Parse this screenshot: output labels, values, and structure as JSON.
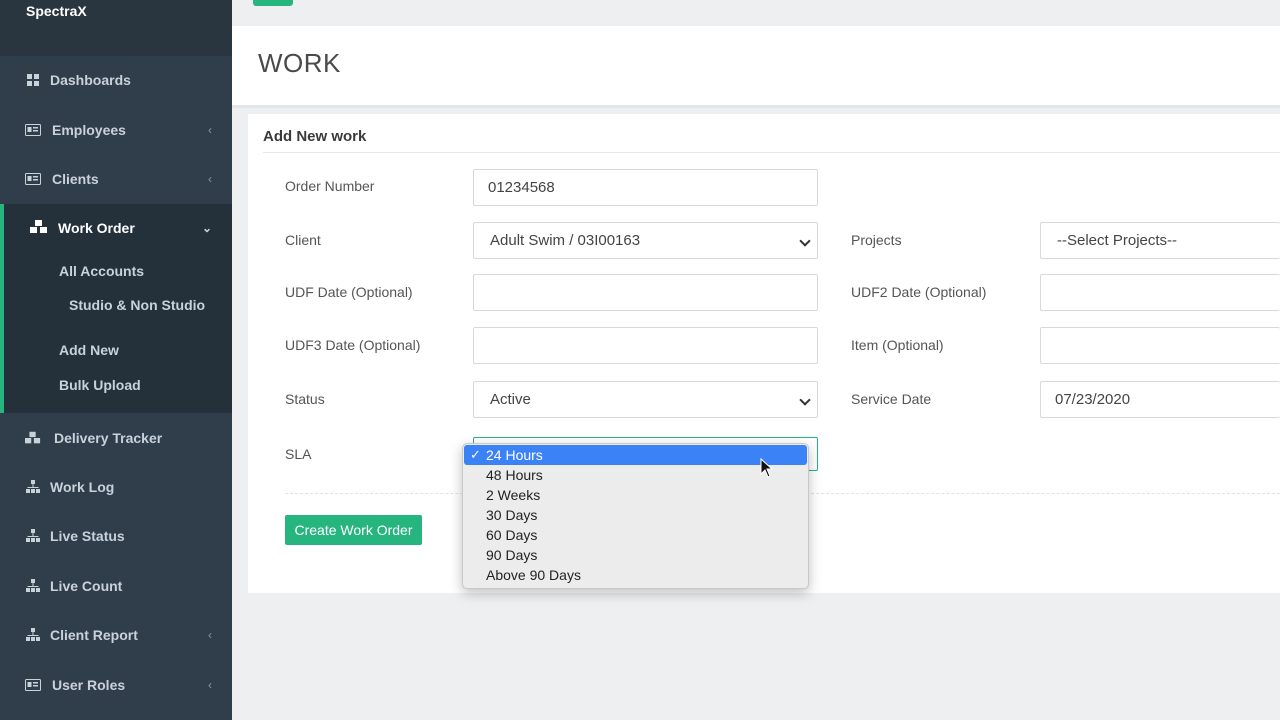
{
  "app": {
    "brand": "SpectraX"
  },
  "sidebar": {
    "items": [
      {
        "label": "Dashboards",
        "icon": "grid-icon",
        "has_chevron": false
      },
      {
        "label": "Employees",
        "icon": "id-card-icon",
        "has_chevron": true
      },
      {
        "label": "Clients",
        "icon": "id-card-icon",
        "has_chevron": true
      },
      {
        "label": "Delivery Tracker",
        "icon": "cubes-icon",
        "has_chevron": false
      },
      {
        "label": "Work Log",
        "icon": "sitemap-icon",
        "has_chevron": false
      },
      {
        "label": "Live Status",
        "icon": "sitemap-icon",
        "has_chevron": false
      },
      {
        "label": "Live Count",
        "icon": "sitemap-icon",
        "has_chevron": false
      },
      {
        "label": "Client Report",
        "icon": "sitemap-icon",
        "has_chevron": true
      },
      {
        "label": "User Roles",
        "icon": "id-card-icon",
        "has_chevron": true
      }
    ],
    "work_order": {
      "label": "Work Order",
      "icon": "cubes-icon",
      "subitems": [
        "All Accounts",
        "Studio & Non Studio",
        "Add New",
        "Bulk Upload"
      ]
    }
  },
  "page": {
    "title": "WORK"
  },
  "form": {
    "title": "Add New work",
    "order_number": {
      "label": "Order Number",
      "value": "01234568"
    },
    "client": {
      "label": "Client",
      "value": "Adult Swim / 03I00163"
    },
    "projects": {
      "label": "Projects",
      "value": "--Select Projects--"
    },
    "udf_date": {
      "label": "UDF Date (Optional)",
      "value": ""
    },
    "udf2_date": {
      "label": "UDF2 Date (Optional)",
      "value": ""
    },
    "udf3_date": {
      "label": "UDF3 Date (Optional)",
      "value": ""
    },
    "item": {
      "label": "Item (Optional)",
      "value": ""
    },
    "status": {
      "label": "Status",
      "value": "Active"
    },
    "service_date": {
      "label": "Service Date",
      "value": "07/23/2020"
    },
    "sla": {
      "label": "SLA",
      "selected": "24 Hours",
      "options": [
        "24 Hours",
        "48 Hours",
        "2 Weeks",
        "30 Days",
        "60 Days",
        "90 Days",
        "Above 90 Days"
      ]
    },
    "submit_label": "Create Work Order"
  },
  "colors": {
    "sidebar_bg": "#2f3e4a",
    "accent": "#26b47f",
    "selection": "#3b82f6"
  }
}
